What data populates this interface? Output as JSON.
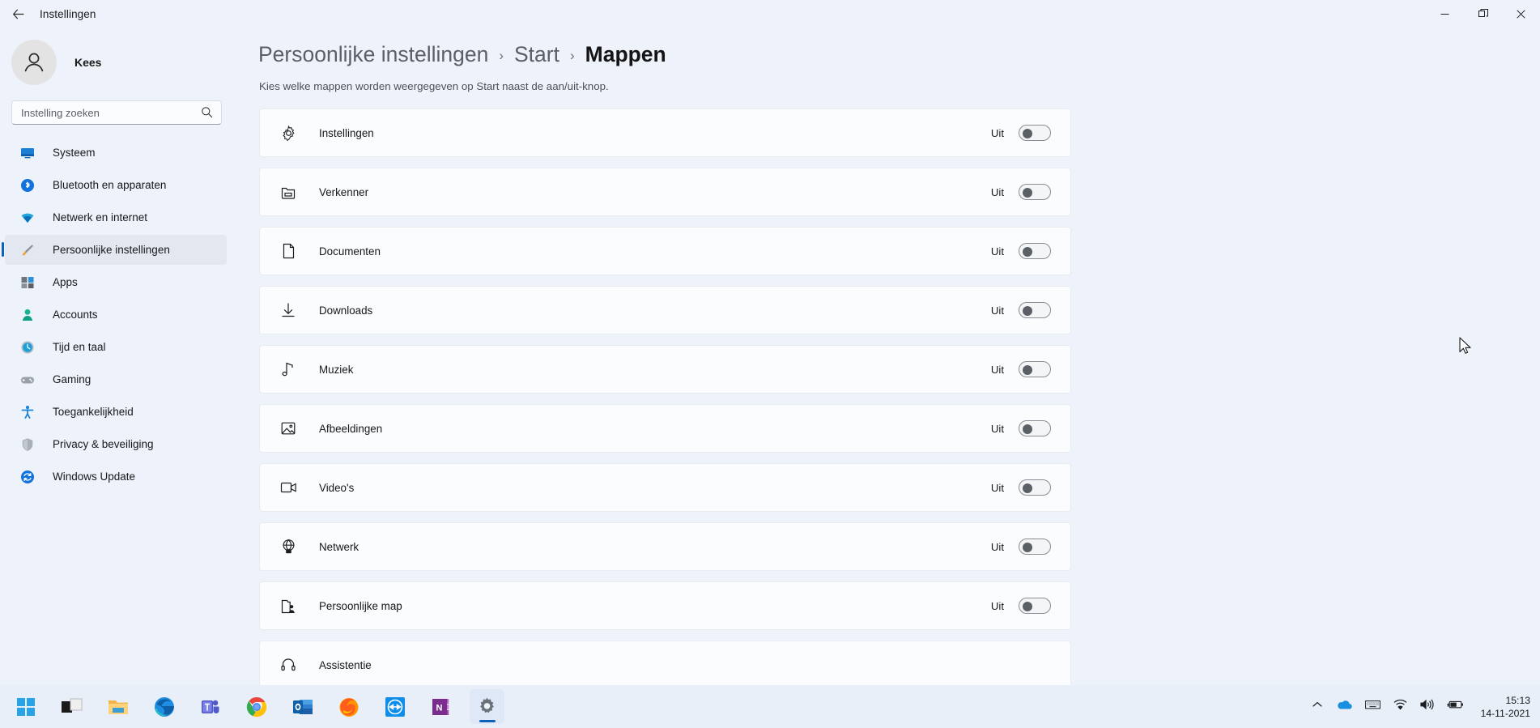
{
  "window": {
    "title": "Instellingen",
    "back_icon": "back-arrow-icon",
    "minimize": "–",
    "maximize": "❐",
    "close": "✕"
  },
  "sidebar": {
    "profile": {
      "name": "Kees",
      "avatar_icon": "person-avatar-icon"
    },
    "search": {
      "placeholder": "Instelling zoeken",
      "value": "",
      "icon": "search-icon"
    },
    "items": [
      {
        "label": "Systeem",
        "icon": "monitor-icon",
        "active": false
      },
      {
        "label": "Bluetooth en apparaten",
        "icon": "bluetooth-icon",
        "active": false
      },
      {
        "label": "Netwerk en internet",
        "icon": "wifi-icon",
        "active": false
      },
      {
        "label": "Persoonlijke instellingen",
        "icon": "paintbrush-icon",
        "active": true
      },
      {
        "label": "Apps",
        "icon": "apps-grid-icon",
        "active": false
      },
      {
        "label": "Accounts",
        "icon": "person-icon",
        "active": false
      },
      {
        "label": "Tijd en taal",
        "icon": "clock-globe-icon",
        "active": false
      },
      {
        "label": "Gaming",
        "icon": "gamepad-icon",
        "active": false
      },
      {
        "label": "Toegankelijkheid",
        "icon": "accessibility-icon",
        "active": false
      },
      {
        "label": "Privacy & beveiliging",
        "icon": "shield-icon",
        "active": false
      },
      {
        "label": "Windows Update",
        "icon": "update-refresh-icon",
        "active": false
      }
    ]
  },
  "main": {
    "breadcrumb": {
      "root": "Persoonlijke instellingen",
      "middle": "Start",
      "current": "Mappen",
      "separator": "›"
    },
    "subtitle": "Kies welke mappen worden weergegeven op Start naast de aan/uit-knop.",
    "rows": [
      {
        "label": "Instellingen",
        "icon": "gear-icon",
        "state": "Uit",
        "on": false
      },
      {
        "label": "Verkenner",
        "icon": "folder-icon",
        "state": "Uit",
        "on": false
      },
      {
        "label": "Documenten",
        "icon": "document-icon",
        "state": "Uit",
        "on": false
      },
      {
        "label": "Downloads",
        "icon": "download-arrow-icon",
        "state": "Uit",
        "on": false
      },
      {
        "label": "Muziek",
        "icon": "music-note-icon",
        "state": "Uit",
        "on": false
      },
      {
        "label": "Afbeeldingen",
        "icon": "picture-icon",
        "state": "Uit",
        "on": false
      },
      {
        "label": "Video's",
        "icon": "video-camera-icon",
        "state": "Uit",
        "on": false
      },
      {
        "label": "Netwerk",
        "icon": "network-globe-icon",
        "state": "Uit",
        "on": false
      },
      {
        "label": "Persoonlijke map",
        "icon": "user-folder-icon",
        "state": "Uit",
        "on": false
      },
      {
        "label": "Assistentie",
        "icon": "assist-icon",
        "state": "",
        "on": false
      }
    ]
  },
  "taskbar": {
    "items": [
      {
        "name": "start",
        "label": "Start"
      },
      {
        "name": "task-view",
        "label": "Taakweergave"
      },
      {
        "name": "file-explorer",
        "label": "Verkenner"
      },
      {
        "name": "edge",
        "label": "Microsoft Edge"
      },
      {
        "name": "teams",
        "label": "Microsoft Teams"
      },
      {
        "name": "chrome",
        "label": "Google Chrome"
      },
      {
        "name": "outlook",
        "label": "Outlook"
      },
      {
        "name": "firefox",
        "label": "Firefox"
      },
      {
        "name": "teamviewer",
        "label": "TeamViewer"
      },
      {
        "name": "onenote",
        "label": "OneNote"
      },
      {
        "name": "settings",
        "label": "Instellingen"
      }
    ],
    "tray": {
      "chevron": "show-hidden-icons",
      "onedrive": "onedrive-icon",
      "keyboard": "keyboard-icon",
      "wifi": "wifi-icon",
      "volume": "volume-icon",
      "battery": "battery-charging-icon",
      "time": "15:13",
      "date": "14-11-2021"
    }
  }
}
